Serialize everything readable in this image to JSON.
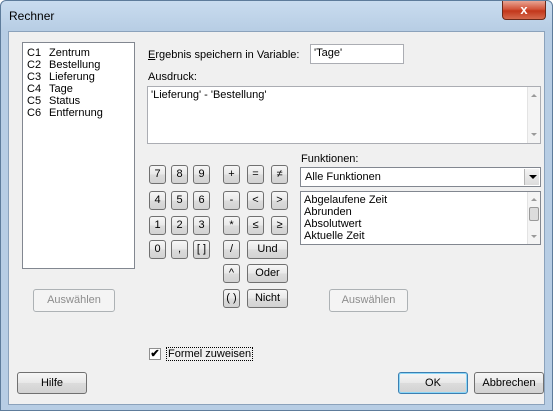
{
  "window": {
    "title": "Rechner",
    "close_glyph": "x"
  },
  "variables": [
    {
      "id": "C1",
      "name": "Zentrum"
    },
    {
      "id": "C2",
      "name": "Bestellung"
    },
    {
      "id": "C3",
      "name": "Lieferung"
    },
    {
      "id": "C4",
      "name": "Tage"
    },
    {
      "id": "C5",
      "name": "Status"
    },
    {
      "id": "C6",
      "name": "Entfernung"
    }
  ],
  "store_result": {
    "label": "Ergebnis speichern in Variable:",
    "value": "'Tage'"
  },
  "expression": {
    "label": "Ausdruck:",
    "value": "'Lieferung' - 'Bestellung'"
  },
  "keypad": [
    "7",
    "8",
    "9",
    "+",
    "=",
    "≠",
    "4",
    "5",
    "6",
    "-",
    "<",
    ">",
    "1",
    "2",
    "3",
    "*",
    "≤",
    "≥",
    "0",
    ",",
    "[ ]",
    "/",
    "Und",
    "^",
    "Oder",
    "( )",
    "Nicht"
  ],
  "functions": {
    "label": "Funktionen:",
    "selected": "Alle Funktionen",
    "items": [
      "Abgelaufene Zeit",
      "Abrunden",
      "Absolutwert",
      "Aktuelle Zeit"
    ]
  },
  "buttons": {
    "select_left": "Auswählen",
    "select_right": "Auswählen",
    "help": "Hilfe",
    "ok": "OK",
    "cancel": "Abbrechen"
  },
  "assign_formula": {
    "label": "Formel zuweisen",
    "checked": true,
    "check_glyph": "✔"
  }
}
